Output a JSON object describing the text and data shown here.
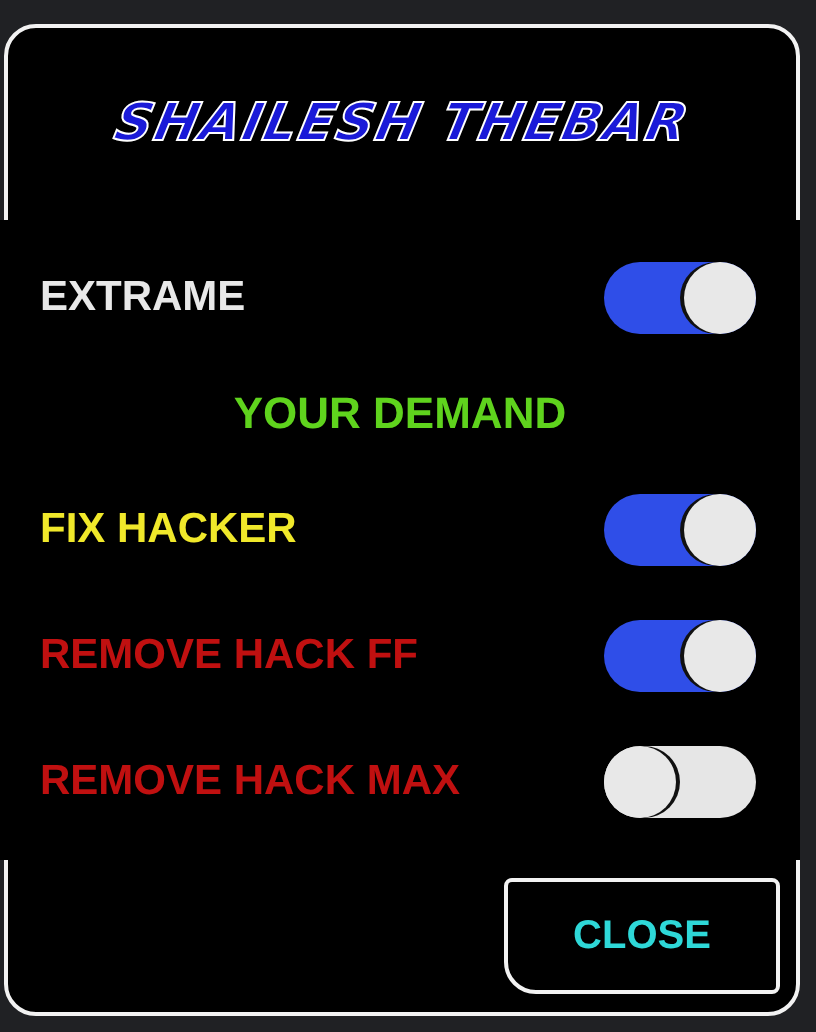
{
  "dialog": {
    "title": "SHAILESH THEBAR",
    "items": [
      {
        "kind": "toggle",
        "label": "EXTRAME",
        "color": "#e8e8e8",
        "on": true
      },
      {
        "kind": "heading",
        "label": "YOUR DEMAND",
        "color": "#5fd31d"
      },
      {
        "kind": "toggle",
        "label": "FIX HACKER",
        "color": "#f0e82a",
        "on": true
      },
      {
        "kind": "toggle",
        "label": "REMOVE HACK FF",
        "color": "#c01010",
        "on": true
      },
      {
        "kind": "toggle",
        "label": "REMOVE HACK MAX",
        "color": "#c01010",
        "on": false
      }
    ],
    "close_button": "CLOSE"
  }
}
